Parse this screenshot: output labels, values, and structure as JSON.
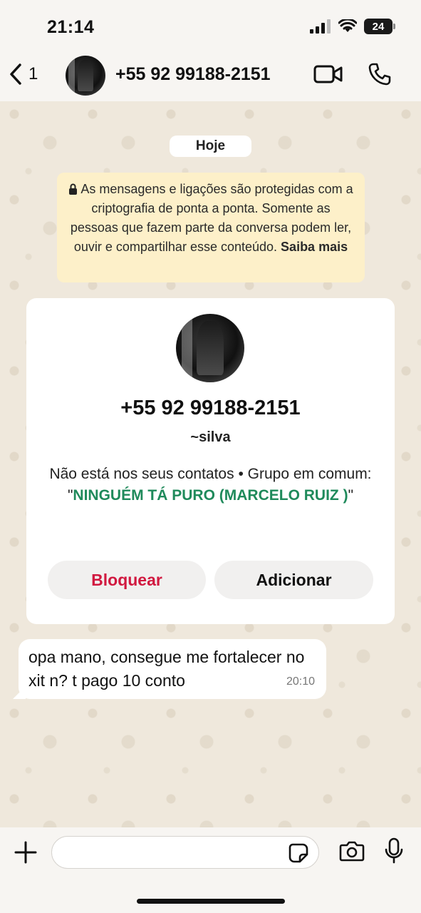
{
  "status_bar": {
    "time": "21:14",
    "battery": "24"
  },
  "header": {
    "back_count": "1",
    "title": "+55 92 99188-2151"
  },
  "date_pill": "Hoje",
  "encryption_notice": {
    "text": "As mensagens e ligações são protegidas com a criptografia de ponta a ponta. Somente as pessoas que fazem parte da conversa podem ler, ouvir e compartilhar esse conteúdo.",
    "link": "Saiba mais"
  },
  "contact_card": {
    "phone": "+55 92 99188-2151",
    "nickname": "~silva",
    "info_prefix": "Não está nos seus contatos • Grupo em comum: \"",
    "group_name": "NINGUÉM TÁ PURO (MARCELO RUIZ )",
    "info_suffix": "\"",
    "block_label": "Bloquear",
    "add_label": "Adicionar"
  },
  "messages": [
    {
      "text": "opa mano, consegue me fortalecer no xit n? t pago 10 conto",
      "time": "20:10"
    }
  ],
  "composer": {
    "placeholder": ""
  },
  "colors": {
    "accent_green": "#1f8a5b",
    "block_red": "#d1183f",
    "notice_bg": "#fdf0c9"
  }
}
